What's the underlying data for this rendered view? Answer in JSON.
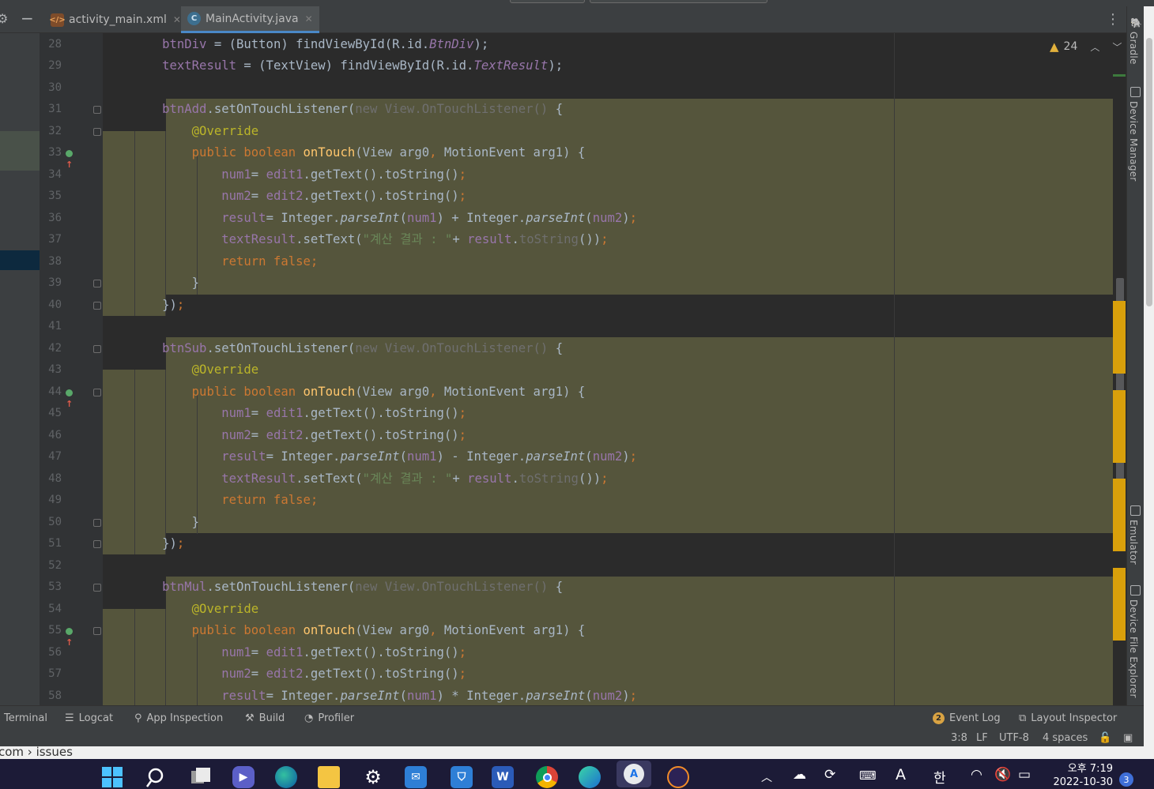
{
  "tabs": [
    {
      "label": "activity_main.xml",
      "icon": "xml-file-icon",
      "active": false
    },
    {
      "label": "MainActivity.java",
      "icon": "java-class-icon",
      "active": true
    }
  ],
  "inspection": {
    "warnings": "24"
  },
  "line_numbers": [
    "28",
    "29",
    "30",
    "31",
    "32",
    "33",
    "34",
    "35",
    "36",
    "37",
    "38",
    "39",
    "40",
    "41",
    "42",
    "43",
    "44",
    "45",
    "46",
    "47",
    "48",
    "49",
    "50",
    "51",
    "52",
    "53",
    "54",
    "55",
    "56",
    "57",
    "58"
  ],
  "code_lines": [
    [
      {
        "t": "        "
      },
      {
        "t": "btnDiv",
        "c": "f"
      },
      {
        "t": " = (Button) findViewById(R.id."
      },
      {
        "t": "BtnDiv",
        "c": "fi"
      },
      {
        "t": ");"
      }
    ],
    [
      {
        "t": "        "
      },
      {
        "t": "textResult",
        "c": "f"
      },
      {
        "t": " = (TextView) findViewById(R.id."
      },
      {
        "t": "TextResult",
        "c": "fi"
      },
      {
        "t": ");"
      }
    ],
    [],
    [
      {
        "t": "        "
      },
      {
        "t": "btnAdd",
        "c": "f"
      },
      {
        "t": ".setOnTouchListener("
      },
      {
        "t": "new View.OnTouchListener()",
        "c": "g"
      },
      {
        "t": " {"
      }
    ],
    [
      {
        "t": "            "
      },
      {
        "t": "@Override",
        "c": "a"
      }
    ],
    [
      {
        "t": "            "
      },
      {
        "t": "public boolean ",
        "c": "k"
      },
      {
        "t": "onTouch",
        "c": "m"
      },
      {
        "t": "(View arg0"
      },
      {
        "t": ", ",
        "c": "k"
      },
      {
        "t": "MotionEvent arg1) {"
      }
    ],
    [
      {
        "t": "                "
      },
      {
        "t": "num1",
        "c": "f"
      },
      {
        "t": "= "
      },
      {
        "t": "edit1",
        "c": "f"
      },
      {
        "t": ".getText().toString()"
      },
      {
        "t": ";",
        "c": "k"
      }
    ],
    [
      {
        "t": "                "
      },
      {
        "t": "num2",
        "c": "f"
      },
      {
        "t": "= "
      },
      {
        "t": "edit2",
        "c": "f"
      },
      {
        "t": ".getText().toString()"
      },
      {
        "t": ";",
        "c": "k"
      }
    ],
    [
      {
        "t": "                "
      },
      {
        "t": "result",
        "c": "f"
      },
      {
        "t": "= Integer."
      },
      {
        "t": "parseInt",
        "c": "it"
      },
      {
        "t": "("
      },
      {
        "t": "num1",
        "c": "f"
      },
      {
        "t": ") + Integer."
      },
      {
        "t": "parseInt",
        "c": "it"
      },
      {
        "t": "("
      },
      {
        "t": "num2",
        "c": "f"
      },
      {
        "t": ")"
      },
      {
        "t": ";",
        "c": "k"
      }
    ],
    [
      {
        "t": "                "
      },
      {
        "t": "textResult",
        "c": "f"
      },
      {
        "t": ".setText("
      },
      {
        "t": "\"계산 결과 : \"",
        "c": "s"
      },
      {
        "t": "+ "
      },
      {
        "t": "result",
        "c": "f"
      },
      {
        "t": "."
      },
      {
        "t": "toString",
        "c": "g"
      },
      {
        "t": "())"
      },
      {
        "t": ";",
        "c": "k"
      }
    ],
    [
      {
        "t": "                "
      },
      {
        "t": "return false;",
        "c": "k"
      }
    ],
    [
      {
        "t": "            }"
      }
    ],
    [
      {
        "t": "        })"
      },
      {
        "t": ";",
        "c": "k"
      }
    ],
    [],
    [
      {
        "t": "        "
      },
      {
        "t": "btnSub",
        "c": "f"
      },
      {
        "t": ".setOnTouchListener("
      },
      {
        "t": "new View.OnTouchListener()",
        "c": "g"
      },
      {
        "t": " {"
      }
    ],
    [
      {
        "t": "            "
      },
      {
        "t": "@Override",
        "c": "a"
      }
    ],
    [
      {
        "t": "            "
      },
      {
        "t": "public boolean ",
        "c": "k"
      },
      {
        "t": "onTouch",
        "c": "m"
      },
      {
        "t": "(View arg0"
      },
      {
        "t": ", ",
        "c": "k"
      },
      {
        "t": "MotionEvent arg1) {"
      }
    ],
    [
      {
        "t": "                "
      },
      {
        "t": "num1",
        "c": "f"
      },
      {
        "t": "= "
      },
      {
        "t": "edit1",
        "c": "f"
      },
      {
        "t": ".getText().toString()"
      },
      {
        "t": ";",
        "c": "k"
      }
    ],
    [
      {
        "t": "                "
      },
      {
        "t": "num2",
        "c": "f"
      },
      {
        "t": "= "
      },
      {
        "t": "edit2",
        "c": "f"
      },
      {
        "t": ".getText().toString()"
      },
      {
        "t": ";",
        "c": "k"
      }
    ],
    [
      {
        "t": "                "
      },
      {
        "t": "result",
        "c": "f"
      },
      {
        "t": "= Integer."
      },
      {
        "t": "parseInt",
        "c": "it"
      },
      {
        "t": "("
      },
      {
        "t": "num1",
        "c": "f"
      },
      {
        "t": ") - Integer."
      },
      {
        "t": "parseInt",
        "c": "it"
      },
      {
        "t": "("
      },
      {
        "t": "num2",
        "c": "f"
      },
      {
        "t": ")"
      },
      {
        "t": ";",
        "c": "k"
      }
    ],
    [
      {
        "t": "                "
      },
      {
        "t": "textResult",
        "c": "f"
      },
      {
        "t": ".setText("
      },
      {
        "t": "\"계산 결과 : \"",
        "c": "s"
      },
      {
        "t": "+ "
      },
      {
        "t": "result",
        "c": "f"
      },
      {
        "t": "."
      },
      {
        "t": "toString",
        "c": "g"
      },
      {
        "t": "())"
      },
      {
        "t": ";",
        "c": "k"
      }
    ],
    [
      {
        "t": "                "
      },
      {
        "t": "return false;",
        "c": "k"
      }
    ],
    [
      {
        "t": "            }"
      }
    ],
    [
      {
        "t": "        })"
      },
      {
        "t": ";",
        "c": "k"
      }
    ],
    [],
    [
      {
        "t": "        "
      },
      {
        "t": "btnMul",
        "c": "f"
      },
      {
        "t": ".setOnTouchListener("
      },
      {
        "t": "new View.OnTouchListener()",
        "c": "g"
      },
      {
        "t": " {"
      }
    ],
    [
      {
        "t": "            "
      },
      {
        "t": "@Override",
        "c": "a"
      }
    ],
    [
      {
        "t": "            "
      },
      {
        "t": "public boolean ",
        "c": "k"
      },
      {
        "t": "onTouch",
        "c": "m"
      },
      {
        "t": "(View arg0"
      },
      {
        "t": ", ",
        "c": "k"
      },
      {
        "t": "MotionEvent arg1) {"
      }
    ],
    [
      {
        "t": "                "
      },
      {
        "t": "num1",
        "c": "f"
      },
      {
        "t": "= "
      },
      {
        "t": "edit1",
        "c": "f"
      },
      {
        "t": ".getText().toString()"
      },
      {
        "t": ";",
        "c": "k"
      }
    ],
    [
      {
        "t": "                "
      },
      {
        "t": "num2",
        "c": "f"
      },
      {
        "t": "= "
      },
      {
        "t": "edit2",
        "c": "f"
      },
      {
        "t": ".getText().toString()"
      },
      {
        "t": ";",
        "c": "k"
      }
    ],
    [
      {
        "t": "                "
      },
      {
        "t": "result",
        "c": "f"
      },
      {
        "t": "= Integer."
      },
      {
        "t": "parseInt",
        "c": "it"
      },
      {
        "t": "("
      },
      {
        "t": "num1",
        "c": "f"
      },
      {
        "t": ") * Integer."
      },
      {
        "t": "parseInt",
        "c": "it"
      },
      {
        "t": "("
      },
      {
        "t": "num2",
        "c": "f"
      },
      {
        "t": ")"
      },
      {
        "t": ";",
        "c": "k"
      }
    ]
  ],
  "right_tools": {
    "gradle": "Gradle",
    "device_manager": "Device Manager",
    "emulator": "Emulator",
    "device_file_explorer": "Device File Explorer"
  },
  "bottom_tools": {
    "terminal": "Terminal",
    "logcat": "Logcat",
    "app_inspection": "App Inspection",
    "build": "Build",
    "profiler": "Profiler",
    "event_log": "Event Log",
    "event_log_count": "2",
    "layout_inspector": "Layout Inspector"
  },
  "status": {
    "position": "3:8",
    "line_sep": "LF",
    "encoding": "UTF-8",
    "indent": "4 spaces"
  },
  "behind_window_text": "com › issues",
  "taskbar": {
    "icons": [
      "windows-start-icon",
      "search-icon",
      "task-view-icon",
      "teams-chat-icon",
      "edge-browser-icon",
      "file-explorer-icon",
      "settings-icon",
      "mail-icon",
      "store-icon",
      "word-icon",
      "chrome-icon",
      "app-icon",
      "android-studio-icon",
      "eclipse-icon"
    ],
    "word_label": "W",
    "tray": {
      "ime": "A",
      "hangul": "한"
    },
    "clock_time": "오후 7:19",
    "clock_date": "2022-10-30",
    "notifications": "3"
  },
  "colors": {
    "bg": "#2b2b2b",
    "highlight": "#55553c",
    "keyword": "#cc7832",
    "field": "#9876aa",
    "method": "#ffc66d",
    "annotation": "#bbb529",
    "string": "#6a8759",
    "accent": "#4a88c7",
    "warning_stripe": "#d9a00b"
  }
}
